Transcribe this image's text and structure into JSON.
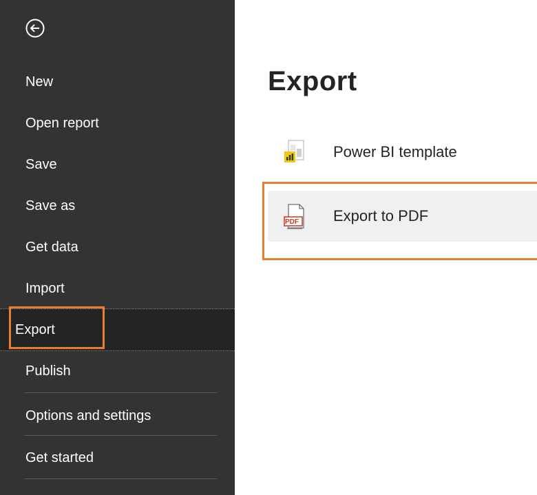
{
  "nav": {
    "items": [
      {
        "label": "New"
      },
      {
        "label": "Open report"
      },
      {
        "label": "Save"
      },
      {
        "label": "Save as"
      },
      {
        "label": "Get data"
      },
      {
        "label": "Import"
      },
      {
        "label": "Export"
      },
      {
        "label": "Publish"
      },
      {
        "label": "Options and settings"
      },
      {
        "label": "Get started"
      }
    ],
    "selected": "Export"
  },
  "main": {
    "title": "Export",
    "options": [
      {
        "label": "Power BI template",
        "icon": "power-bi-template-icon"
      },
      {
        "label": "Export to PDF",
        "icon": "pdf-icon"
      }
    ]
  },
  "icons": {
    "back": "back-arrow-icon"
  },
  "colors": {
    "sidebar_bg": "#333333",
    "selected_bg": "#242424",
    "highlight": "#ed7d31",
    "hover_bg": "#f0f0f0",
    "pbi_yellow": "#f2c811"
  }
}
